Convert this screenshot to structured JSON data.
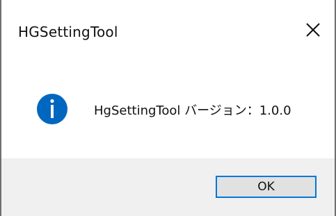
{
  "window": {
    "title": "HGSettingTool",
    "close_icon": "close-icon"
  },
  "message": {
    "icon": "info-icon",
    "text": "HgSettingTool バージョン：1.0.0"
  },
  "buttons": {
    "ok_label": "OK"
  },
  "colors": {
    "info_icon_fill": "#0067c0",
    "button_focus_border": "#0078d7",
    "footer_background": "#f0f0f0"
  }
}
